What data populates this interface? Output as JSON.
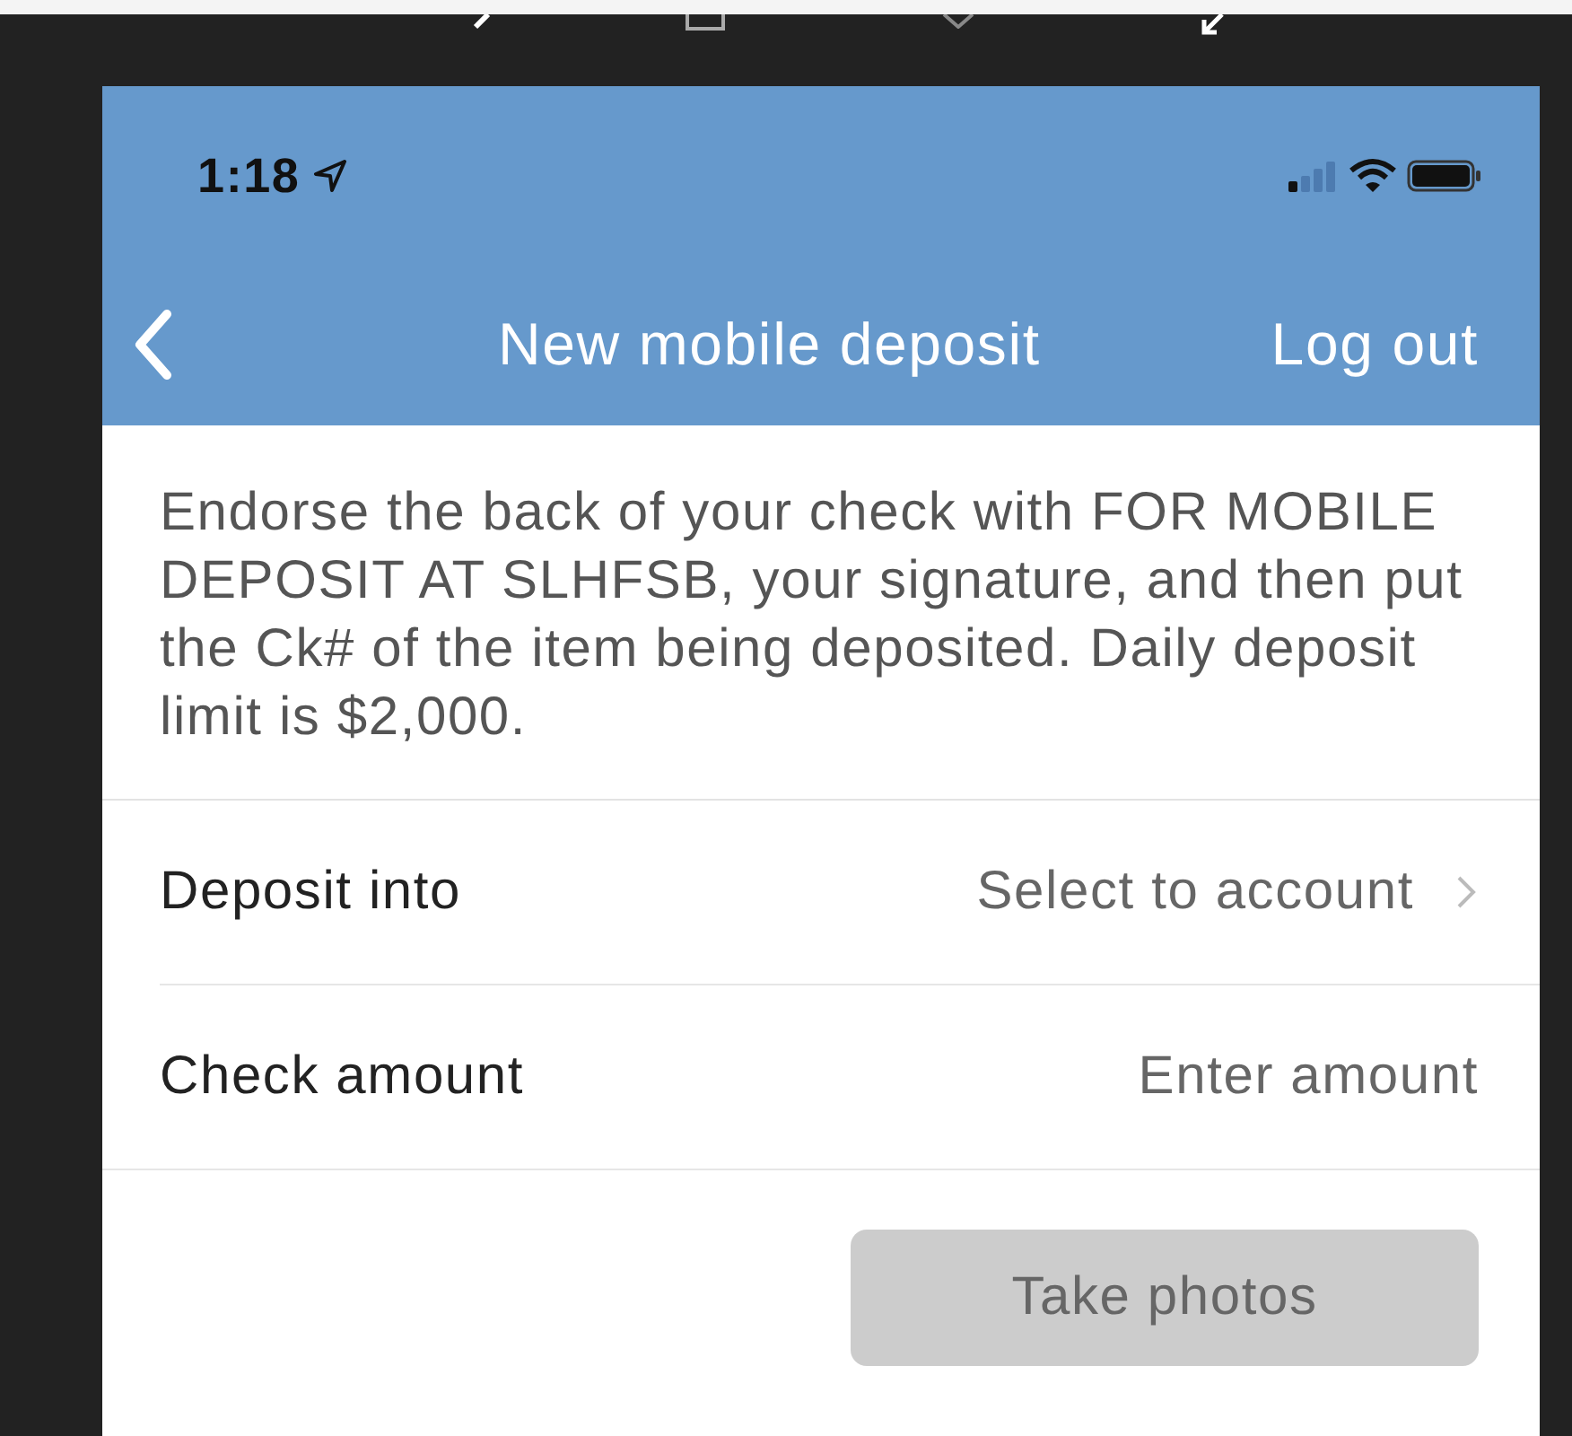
{
  "status_bar": {
    "time": "1:18"
  },
  "nav": {
    "title": "New mobile deposit",
    "action": "Log out"
  },
  "instructions": "Endorse the back of your check with FOR MOBILE DEPOSIT AT SLHFSB, your signature, and then put the Ck# of the item being deposited. Daily deposit limit is $2,000.",
  "rows": [
    {
      "kind": "select",
      "label": "Deposit into",
      "value": "Select to account"
    },
    {
      "kind": "input",
      "label": "Check amount",
      "placeholder": "Enter amount"
    }
  ],
  "button": {
    "label": "Take photos",
    "disabled": true
  }
}
